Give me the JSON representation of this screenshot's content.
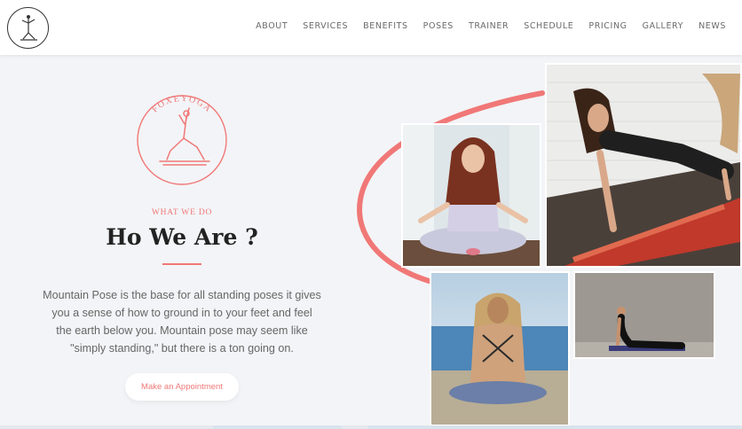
{
  "header": {
    "logo_icon": "yoga-pose-logo-icon",
    "nav": [
      "ABOUT",
      "SERVICES",
      "BENEFITS",
      "POSES",
      "TRAINER",
      "SCHEDULE",
      "PRICING",
      "GALLERY",
      "NEWS"
    ]
  },
  "brand": {
    "name": "FOXEYOGA"
  },
  "section": {
    "eyebrow": "WHAT WE DO",
    "title": "Ho We Are ?",
    "body": "Mountain Pose is the base for all standing poses it gives you a sense of how to ground in to your feet and feel the earth below you. Mountain pose may seem like \"simply standing,\" but there is a ton going on.",
    "cta_label": "Make an Appointment"
  },
  "gallery": {
    "photos": [
      "meditation-photo",
      "plank-photo",
      "beach-meditation-photo",
      "cobra-pose-photo"
    ]
  },
  "colors": {
    "accent": "#f07877",
    "background": "#f3f4f7",
    "text": "#222222",
    "muted": "#666666"
  }
}
